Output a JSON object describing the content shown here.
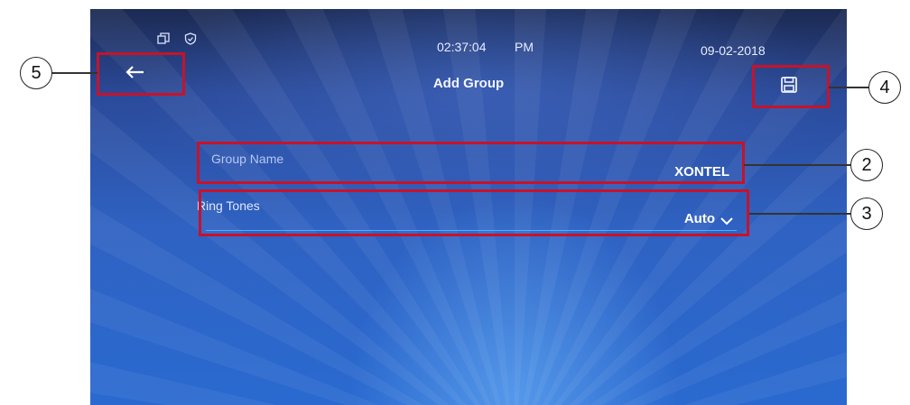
{
  "status_bar": {
    "time": "02:37:04",
    "ampm": "PM",
    "date": "09-02-2018",
    "icons": [
      "window-restore-icon",
      "shield-check-icon"
    ]
  },
  "header": {
    "title": "Add Group",
    "back_icon": "arrow-left-icon",
    "save_icon": "floppy-disk-icon"
  },
  "form": {
    "group_name": {
      "label": "Group Name",
      "value": "XONTEL"
    },
    "ring_tones": {
      "label": "Ring Tones",
      "value": "Auto"
    }
  },
  "callouts": [
    "2",
    "3",
    "4",
    "5"
  ],
  "colors": {
    "highlight": "#c8122a",
    "screen_blue": "#2f62c2"
  }
}
